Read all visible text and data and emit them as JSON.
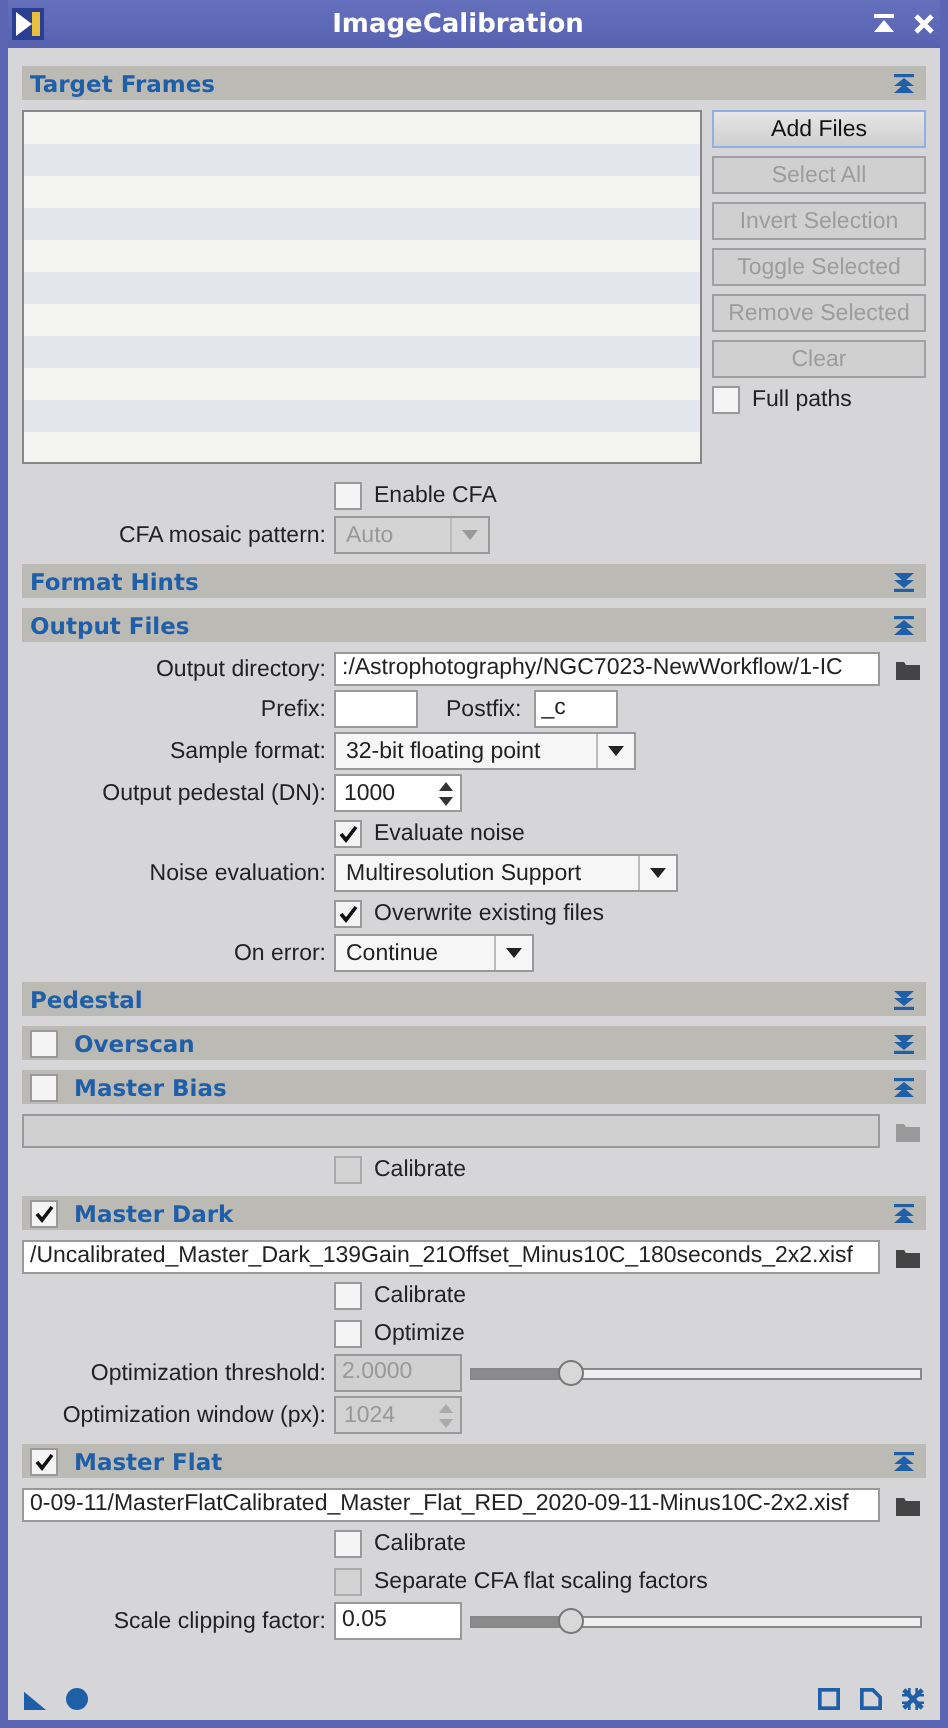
{
  "window": {
    "title": "ImageCalibration"
  },
  "sections": [
    {
      "title": "Target Frames",
      "expanded": true,
      "rows": [
        {
          "kind": "filelist",
          "buttons": [
            {
              "label": "Add Files",
              "disabled": false
            },
            {
              "label": "Select All",
              "disabled": true
            },
            {
              "label": "Invert Selection",
              "disabled": true
            },
            {
              "label": "Toggle Selected",
              "disabled": true
            },
            {
              "label": "Remove Selected",
              "disabled": true
            },
            {
              "label": "Clear",
              "disabled": true
            }
          ],
          "option": {
            "label": "Full paths",
            "checked": false
          }
        },
        {
          "kind": "checkbox",
          "label": "Enable CFA",
          "checked": false,
          "disabled": false
        },
        {
          "kind": "combo",
          "label": "CFA mosaic pattern:",
          "value": "Auto",
          "disabled": true
        }
      ]
    },
    {
      "title": "Format Hints",
      "expanded": false
    },
    {
      "title": "Output Files",
      "expanded": true,
      "rows": [
        {
          "kind": "path",
          "label": "Output directory:",
          "value": ":/Astrophotography/NGC7023-NewWorkflow/1-IC",
          "disabled": false
        },
        {
          "kind": "pair",
          "label": "Prefix:",
          "value": "",
          "label2": "Postfix:",
          "value2": "_c"
        },
        {
          "kind": "combo",
          "label": "Sample format:",
          "value": "32-bit floating point",
          "disabled": false
        },
        {
          "kind": "spin",
          "label": "Output pedestal (DN):",
          "value": "1000",
          "disabled": false
        },
        {
          "kind": "checkbox",
          "label": "Evaluate noise",
          "checked": true,
          "disabled": false
        },
        {
          "kind": "combo",
          "label": "Noise evaluation:",
          "value": "Multiresolution Support",
          "disabled": false
        },
        {
          "kind": "checkbox",
          "label": "Overwrite existing files",
          "checked": true,
          "disabled": false
        },
        {
          "kind": "combo",
          "label": "On error:",
          "value": "Continue",
          "disabled": false
        }
      ]
    },
    {
      "title": "Pedestal",
      "expanded": false
    },
    {
      "title": "Overscan",
      "expanded": false,
      "checked": false
    },
    {
      "title": "Master Bias",
      "expanded": true,
      "checked": false,
      "rows": [
        {
          "kind": "path",
          "value": "",
          "disabled": true
        },
        {
          "kind": "checkbox",
          "label": "Calibrate",
          "checked": false,
          "disabled": true
        }
      ]
    },
    {
      "title": "Master Dark",
      "expanded": true,
      "checked": true,
      "rows": [
        {
          "kind": "path",
          "value": "/Uncalibrated_Master_Dark_139Gain_21Offset_Minus10C_180seconds_2x2.xisf",
          "disabled": false
        },
        {
          "kind": "checkbox",
          "label": "Calibrate",
          "checked": false,
          "disabled": false
        },
        {
          "kind": "checkbox",
          "label": "Optimize",
          "checked": false,
          "disabled": false
        },
        {
          "kind": "slider",
          "label": "Optimization threshold:",
          "value": "2.0000",
          "level": 0.22,
          "disabled": true
        },
        {
          "kind": "spin",
          "label": "Optimization window (px):",
          "value": "1024",
          "disabled": true
        }
      ]
    },
    {
      "title": "Master Flat",
      "expanded": true,
      "checked": true,
      "rows": [
        {
          "kind": "path",
          "value": "0-09-11/MasterFlatCalibrated_Master_Flat_RED_2020-09-11-Minus10C-2x2.xisf",
          "disabled": false
        },
        {
          "kind": "checkbox",
          "label": "Calibrate",
          "checked": false,
          "disabled": false
        },
        {
          "kind": "checkbox",
          "label": "Separate CFA flat scaling factors",
          "checked": false,
          "disabled": true
        },
        {
          "kind": "slider",
          "label": "Scale clipping factor:",
          "value": "0.05",
          "level": 0.22,
          "disabled": false
        }
      ]
    }
  ]
}
